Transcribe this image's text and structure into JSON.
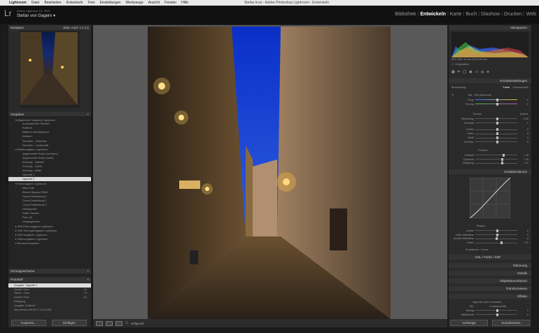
{
  "menubar": {
    "items": [
      "Lightroom",
      "Datei",
      "Bearbeiten",
      "Entwickeln",
      "Foto",
      "Einstellungen",
      "Werkzeuge",
      "Ansicht",
      "Fenster",
      "Hilfe"
    ],
    "window_title": "Stefan.lrcat - Adobe Photoshop Lightroom - Entwickeln"
  },
  "identity": {
    "logo": "Lr",
    "product": "Adobe Lightroom CC 2015",
    "user": "Stefan von Gagern ▾"
  },
  "modules": [
    "Bibliothek",
    "Entwickeln",
    "Karte",
    "Buch",
    "Diashow",
    "Drucken",
    "Web"
  ],
  "active_module": "Entwickeln",
  "left": {
    "navigator": {
      "title": "Navigator",
      "opts": "Einp. Ausf. 1:1 4:1"
    },
    "presets": {
      "title": "Vorgaben",
      "items": [
        "▾ Allgemeine Vorgaben Lightroom",
        "Automatischer Tonwert",
        "Kraftvoll",
        "Mittlerer Kontrastkurve",
        "Nullwert",
        "Scharfen - Gesichter",
        "Scharfen - Landschaft",
        "▾ Effektvorgaben Lightroom",
        "Abgerundete Ecken (schwarz)",
        "Abgerundete Ecken (weiß)",
        "Körnung - Intensiv",
        "Körnung - Leicht",
        "Körnung - Mittel",
        "Vignette 1",
        "Vignette 2",
        "▾ Farbvorgaben Lightroom",
        "Altes Foto",
        "Bleach Bypass-Effekt",
        "Cross-Entwicklung 1",
        "Cross-Entwicklung 2",
        "Cross-Entwicklung 3",
        "Direktpositiv",
        "Kalter Farbton",
        "Pale Lift",
        "Vergangenheit",
        "▸ S/W-Filtervorgaben Lightroom",
        "▸ S/W-Tonungsvorgaben Lightroom",
        "▸ S/W-Vorgaben Lightroom",
        "▸ Videovorgaben Lightroom",
        "▸ Benutzervorgaben"
      ],
      "selected": "Vignette 2"
    },
    "snapshots": {
      "title": "Schnappschüsse"
    },
    "history": {
      "title": "Protokoll",
      "items": [
        [
          "Vorgabe: Vignette 2",
          ""
        ],
        [
          "Dunkle Töne",
          "-11"
        ],
        [
          "Tiefen - Töne",
          "+3"
        ],
        [
          "Dunkle Töne",
          "-12"
        ],
        [
          "Sättigung",
          ""
        ],
        [
          "Vorgabe: Kraftvoll",
          ""
        ],
        [
          "Importieren (06.05.17 14:29:33)",
          ""
        ]
      ],
      "selected": "Vorgabe: Vignette 2"
    },
    "copy_button": "Kopieren...",
    "paste_button": "Einfügen"
  },
  "toolbar": {
    "softproof": "Softproof"
  },
  "right": {
    "histogram": {
      "title": "Histogramm",
      "info": "ISO 1600 11 mm f/4,0 1/8 Sek.",
      "orig": "Originalfoto"
    },
    "basic": {
      "title": "Grundeinstellungen",
      "treatment": "Behandlung:",
      "color": "Farbe",
      "bw": "Schwarzweiß",
      "wb_label": "WA:",
      "wb_value": "Wie Aufnahme",
      "rows": [
        [
          "Temp",
          "0"
        ],
        [
          "Tönung",
          "0"
        ]
      ],
      "tone": "Tonwert",
      "auto": "Autom.",
      "tone_rows": [
        [
          "Belichtung",
          "0,00"
        ],
        [
          "Kontrast",
          "0"
        ],
        [
          "Lichter",
          "0"
        ],
        [
          "Tiefen",
          "0"
        ],
        [
          "Weiß",
          "0"
        ],
        [
          "Schwarz",
          "0"
        ]
      ],
      "presence": "Präsenz",
      "presence_rows": [
        [
          "Klarheit",
          "+ 30"
        ],
        [
          "Dynamik",
          "+ 25"
        ],
        [
          "Sättigung",
          "+ 24"
        ]
      ]
    },
    "curve": {
      "title": "Gradationskurve",
      "region": "Region",
      "rows": [
        [
          "Lichter",
          "0"
        ],
        [
          "Helle Mitteltöne",
          "0"
        ],
        [
          "Dunkle Mitteltöne",
          "-3"
        ],
        [
          "Tiefen",
          "+ 19"
        ]
      ],
      "channel": "Punktkurve : Linear"
    },
    "hsl": "HSL / Farbe / S/W",
    "panels": [
      "Teiltonung",
      "Details",
      "Objektivkorrekturen",
      "Transformieren",
      "Effekte"
    ],
    "vignette": {
      "title": "Vignette nach Freistellen",
      "style_label": "Stil:",
      "style": "Lichterpriorität",
      "rows": [
        [
          "Betrag",
          "0"
        ],
        [
          "Mittelpunkt",
          "0"
        ]
      ]
    },
    "prev_button": "Vorherige",
    "reset_button": "Zurücksetzen"
  }
}
